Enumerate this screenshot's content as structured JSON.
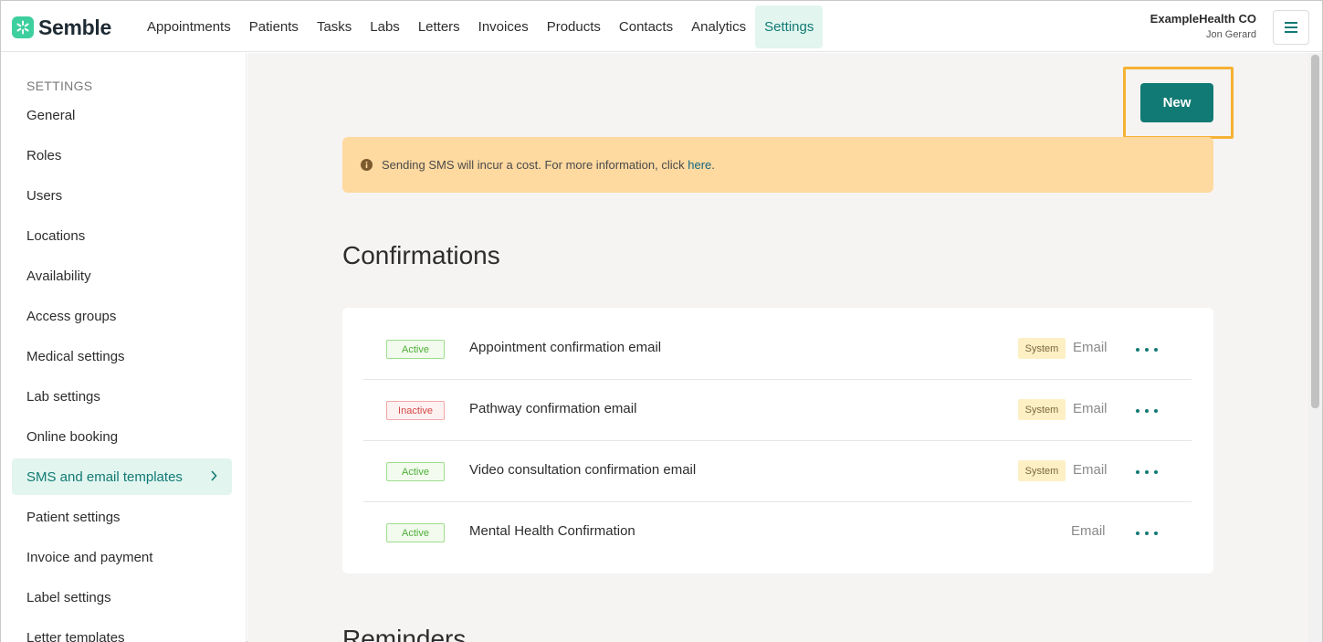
{
  "brand": {
    "name": "Semble",
    "accent": "#127a74",
    "logo_color": "#3ecf9e"
  },
  "nav": {
    "items": [
      {
        "label": "Appointments",
        "active": false
      },
      {
        "label": "Patients",
        "active": false
      },
      {
        "label": "Tasks",
        "active": false
      },
      {
        "label": "Labs",
        "active": false
      },
      {
        "label": "Letters",
        "active": false
      },
      {
        "label": "Invoices",
        "active": false
      },
      {
        "label": "Products",
        "active": false
      },
      {
        "label": "Contacts",
        "active": false
      },
      {
        "label": "Analytics",
        "active": false
      },
      {
        "label": "Settings",
        "active": true
      }
    ]
  },
  "account": {
    "org": "ExampleHealth CO",
    "user": "Jon Gerard",
    "menu_icon": "hamburger-icon"
  },
  "sidebar": {
    "heading": "SETTINGS",
    "items": [
      {
        "label": "General"
      },
      {
        "label": "Roles"
      },
      {
        "label": "Users"
      },
      {
        "label": "Locations"
      },
      {
        "label": "Availability"
      },
      {
        "label": "Access groups"
      },
      {
        "label": "Medical settings"
      },
      {
        "label": "Lab settings"
      },
      {
        "label": "Online booking"
      },
      {
        "label": "SMS and email templates",
        "active": true
      },
      {
        "label": "Patient settings"
      },
      {
        "label": "Invoice and payment"
      },
      {
        "label": "Label settings"
      },
      {
        "label": "Letter templates"
      }
    ]
  },
  "toolbar": {
    "new_label": "New"
  },
  "notice": {
    "text": "Sending SMS will incur a cost. For more information, click ",
    "link": "here",
    "suffix": ".",
    "icon": "info-icon"
  },
  "sections": {
    "confirmations": {
      "title": "Confirmations",
      "rows": [
        {
          "status": "Active",
          "name": "Appointment confirmation email",
          "tag": "System",
          "channel": "Email"
        },
        {
          "status": "Inactive",
          "name": "Pathway confirmation email",
          "tag": "System",
          "channel": "Email"
        },
        {
          "status": "Active",
          "name": "Video consultation confirmation email",
          "tag": "System",
          "channel": "Email"
        },
        {
          "status": "Active",
          "name": "Mental Health Confirmation",
          "tag": "",
          "channel": "Email"
        }
      ]
    },
    "reminders": {
      "title": "Reminders"
    }
  }
}
